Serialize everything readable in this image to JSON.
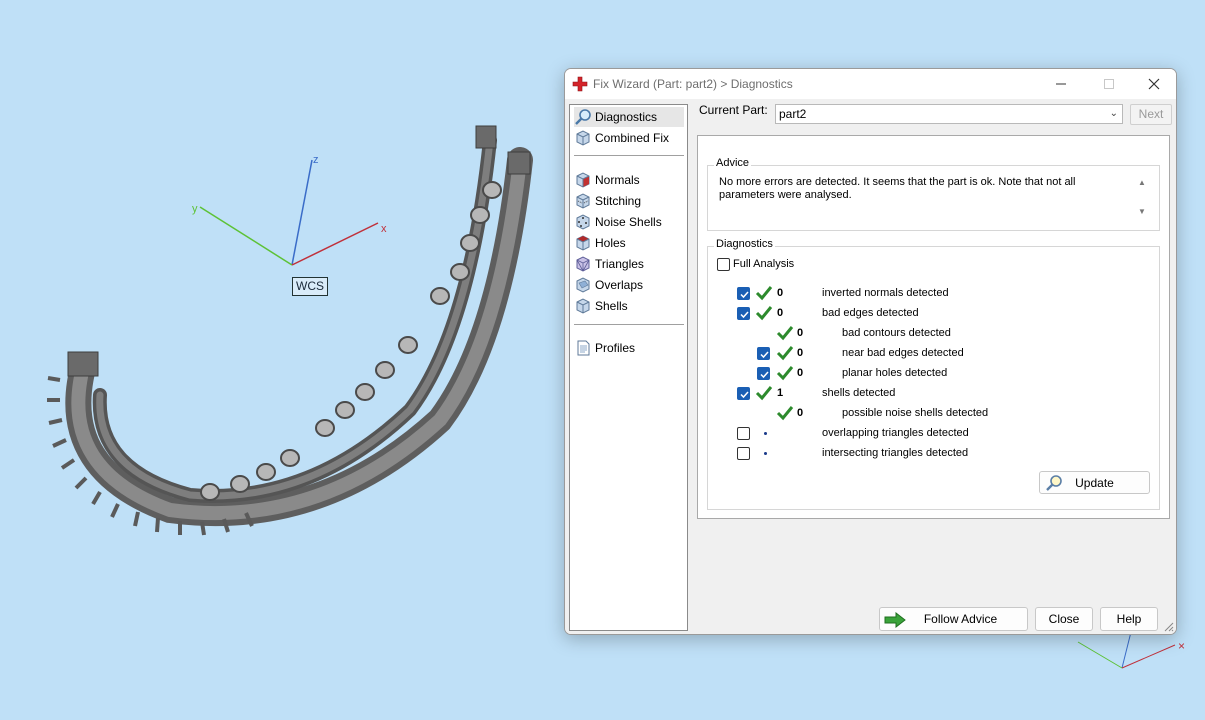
{
  "viewport": {
    "wcs_label": "WCS",
    "axes": {
      "x": "x",
      "y": "y",
      "z": "z"
    }
  },
  "window": {
    "title": "Fix Wizard (Part: part2) > Diagnostics",
    "icons": {
      "title": "red-cross-icon"
    }
  },
  "nav": {
    "items": [
      {
        "label": "Diagnostics",
        "icon": "magnifier-icon"
      },
      {
        "label": "Combined Fix",
        "icon": "cube-icon"
      },
      {
        "label": "Normals",
        "icon": "normals-cube-icon"
      },
      {
        "label": "Stitching",
        "icon": "stitching-cube-icon"
      },
      {
        "label": "Noise Shells",
        "icon": "noise-shells-cube-icon"
      },
      {
        "label": "Holes",
        "icon": "holes-cube-icon"
      },
      {
        "label": "Triangles",
        "icon": "triangles-cube-icon"
      },
      {
        "label": "Overlaps",
        "icon": "overlaps-cube-icon"
      },
      {
        "label": "Shells",
        "icon": "shells-cube-icon"
      },
      {
        "label": "Profiles",
        "icon": "document-icon"
      }
    ]
  },
  "current_part": {
    "label": "Current Part:",
    "value": "part2",
    "next_label": "Next"
  },
  "advice": {
    "title": "Advice",
    "text": "No more errors are detected. It seems that the part is ok. Note that not all parameters were analysed."
  },
  "diagnostics": {
    "title": "Diagnostics",
    "full_analysis_label": "Full Analysis",
    "full_analysis_checked": false,
    "rows": [
      {
        "label": "inverted normals detected",
        "count": "0",
        "checked": true
      },
      {
        "label": "bad edges detected",
        "count": "0",
        "checked": true
      },
      {
        "label": "bad contours detected",
        "count": "0"
      },
      {
        "label": "near bad edges detected",
        "count": "0",
        "checked": true
      },
      {
        "label": "planar holes detected",
        "count": "0",
        "checked": true
      },
      {
        "label": "shells detected",
        "count": "1",
        "checked": true
      },
      {
        "label": "possible noise shells detected",
        "count": "0"
      },
      {
        "label": "overlapping triangles detected",
        "checked": false
      },
      {
        "label": "intersecting triangles detected",
        "checked": false
      }
    ],
    "update_label": "Update"
  },
  "footer": {
    "follow_advice_label": "Follow Advice",
    "close_label": "Close",
    "help_label": "Help"
  },
  "colors": {
    "axis_x": "#c0303a",
    "axis_y": "#5dc236",
    "axis_z": "#3a6cc8",
    "tick_green": "#2d8a2d",
    "checkbox_blue": "#1a5fb4",
    "background": "#bfe0f7",
    "model_gray": "#6f6f6f"
  }
}
